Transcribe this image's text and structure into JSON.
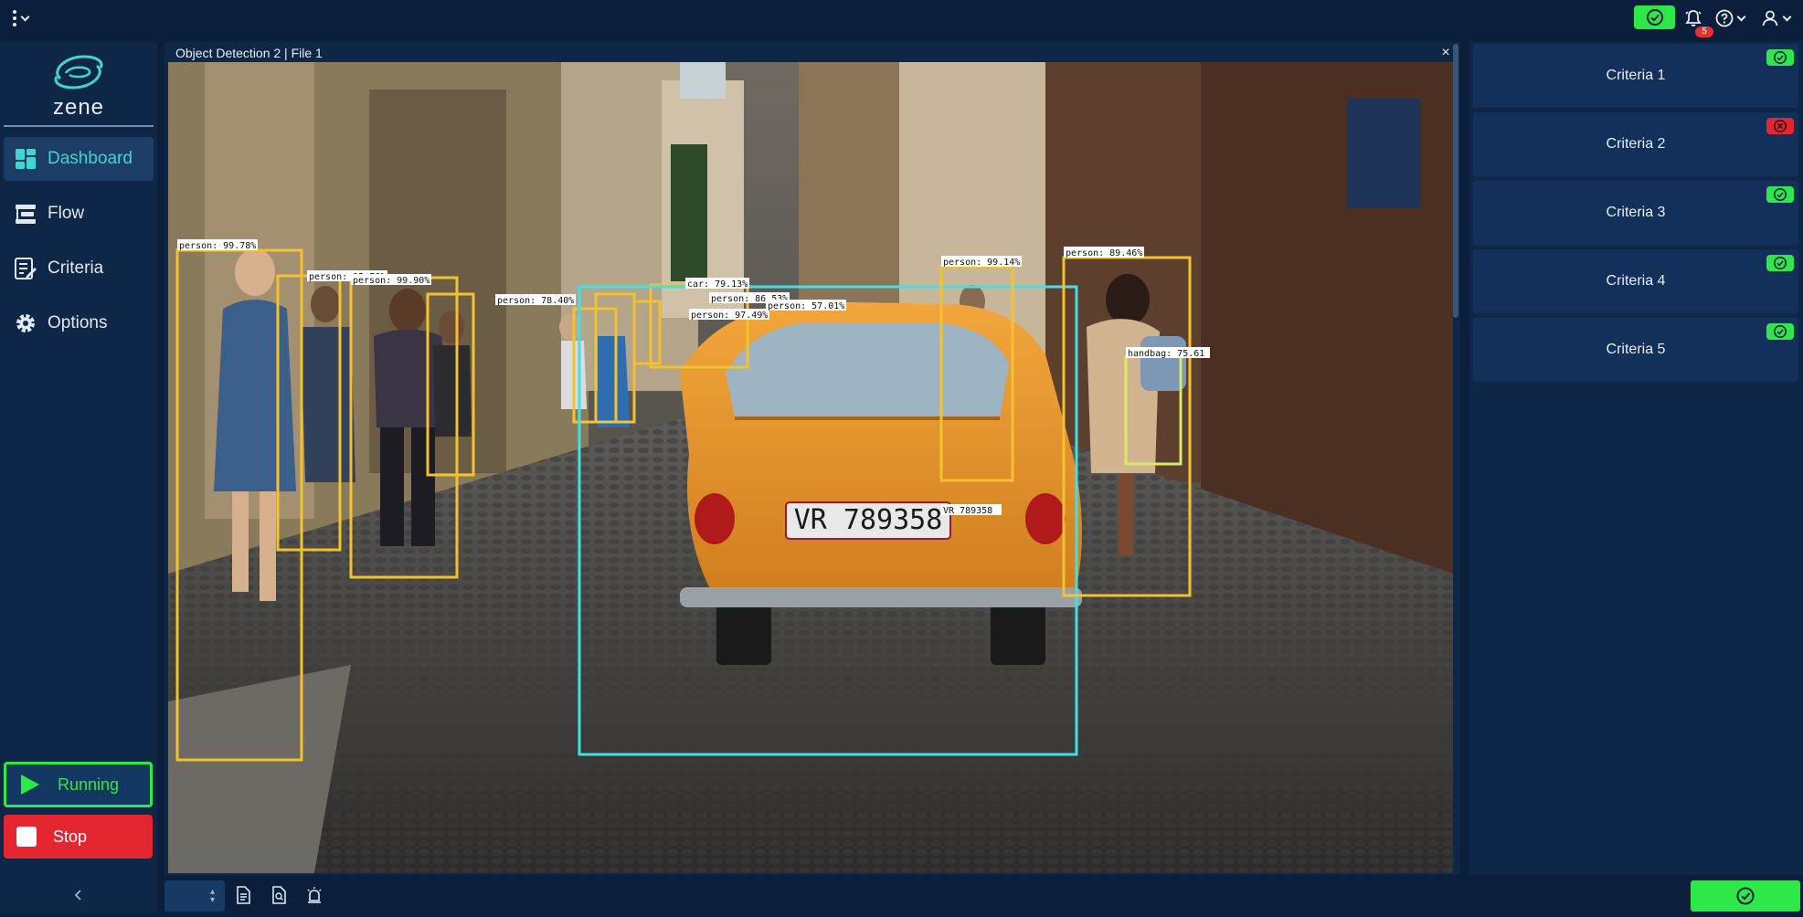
{
  "topbar": {
    "menu_icon": "kebab-menu-icon",
    "status_icon": "check-circle-icon",
    "notifications": {
      "icon": "bell-icon",
      "count": "5"
    },
    "help_icon": "help-circle-icon",
    "user_icon": "user-icon"
  },
  "sidebar": {
    "logo_text": "zene",
    "items": [
      {
        "label": "Dashboard",
        "icon": "dashboard-icon",
        "active": true
      },
      {
        "label": "Flow",
        "icon": "flow-icon",
        "active": false
      },
      {
        "label": "Criteria",
        "icon": "criteria-icon",
        "active": false
      },
      {
        "label": "Options",
        "icon": "gear-icon",
        "active": false
      }
    ],
    "run_label": "Running",
    "stop_label": "Stop"
  },
  "viewer": {
    "title": "Object Detection 2 | File 1",
    "close_glyph": "×",
    "detections": [
      {
        "label": "person: 99.78%",
        "class": "person"
      },
      {
        "label": "person: 95.78%",
        "class": "person"
      },
      {
        "label": "person: 99.90%",
        "class": "person"
      },
      {
        "label": "person: 78.40%",
        "class": "person"
      },
      {
        "label": "car: 79.13%",
        "class": "car"
      },
      {
        "label": "person: 97.49%",
        "class": "person"
      },
      {
        "label": "person: 86.53%",
        "class": "person"
      },
      {
        "label": "person: 57.01%",
        "class": "person"
      },
      {
        "label": "person: 99.14%",
        "class": "person"
      },
      {
        "label": "person: 89.46%",
        "class": "person"
      },
      {
        "label": "handbag: 75.61",
        "class": "handbag"
      },
      {
        "label": "VR 789358",
        "class": "plate"
      }
    ],
    "plate_text": "VR 789358",
    "colors": {
      "person": "#f2c230",
      "car": "#3fe0e6",
      "handbag": "#d8e86a"
    }
  },
  "criteria": [
    {
      "label": "Criteria 1",
      "status": "pass"
    },
    {
      "label": "Criteria 2",
      "status": "fail"
    },
    {
      "label": "Criteria 3",
      "status": "pass"
    },
    {
      "label": "Criteria 4",
      "status": "pass"
    },
    {
      "label": "Criteria 5",
      "status": "pass"
    }
  ],
  "bottombar": {
    "icons": [
      "document-icon",
      "document-search-icon",
      "alarm-icon"
    ],
    "status_icon": "check-circle-icon"
  },
  "colors": {
    "bg": "#0b1f3d",
    "panel": "#0f2747",
    "accent": "#3fd7d1",
    "success": "#2ee84a",
    "danger": "#e3262f"
  }
}
